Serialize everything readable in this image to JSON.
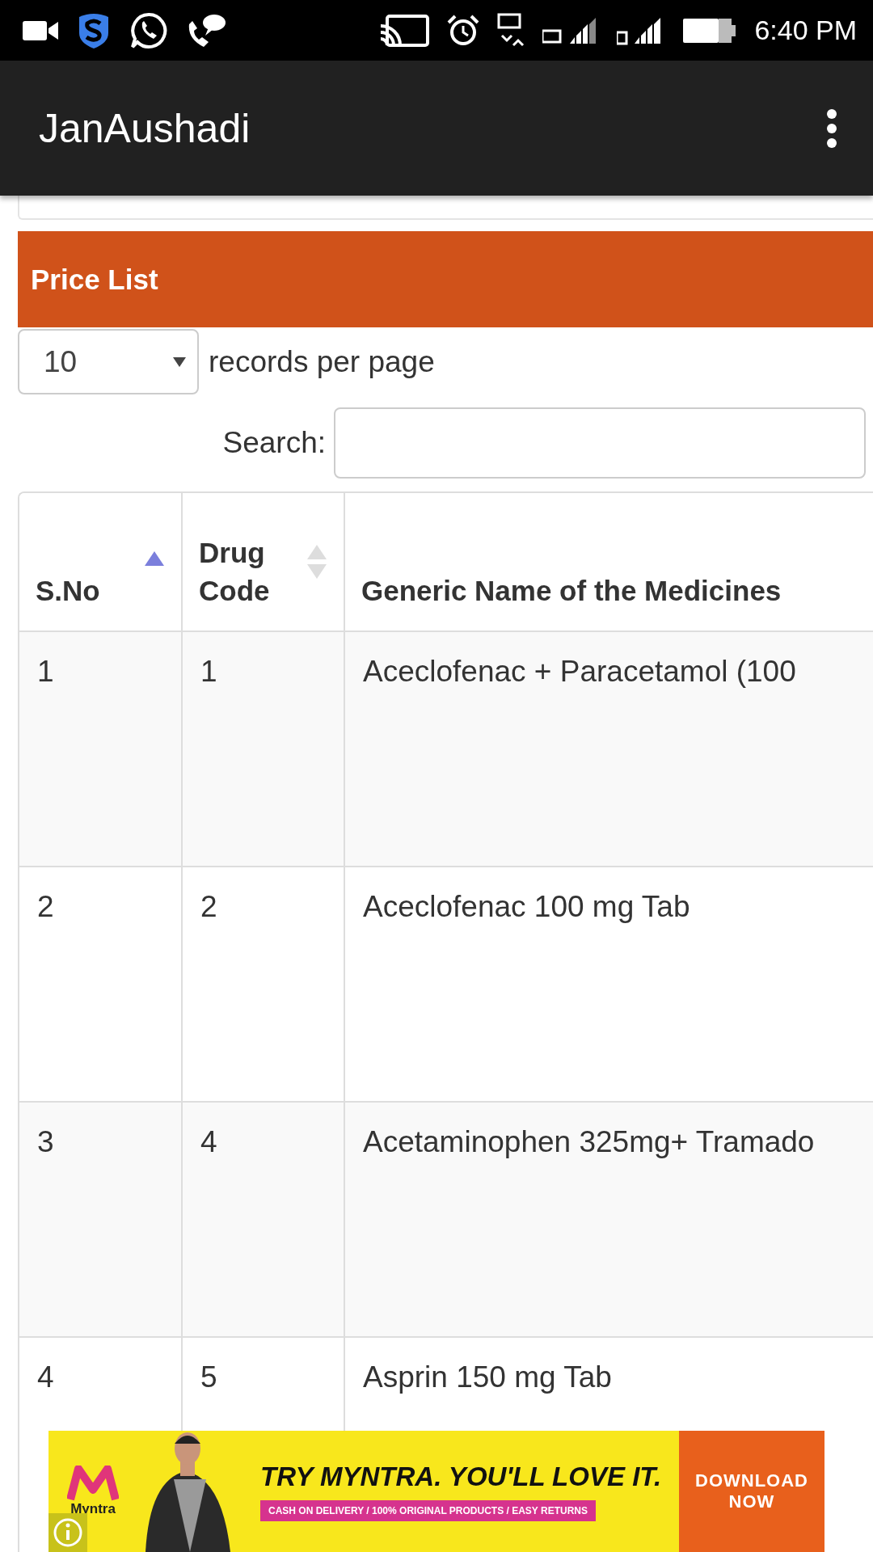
{
  "status_bar": {
    "time": "6:40 PM"
  },
  "app_bar": {
    "title": "JanAushadi"
  },
  "panel": {
    "title": "Price List"
  },
  "length_select": {
    "value": "10",
    "label": "records per page"
  },
  "search": {
    "label": "Search:"
  },
  "table": {
    "columns": [
      {
        "label": "S.No",
        "sortable": true,
        "sorted": true
      },
      {
        "label": "Drug Code",
        "sortable": true,
        "sorted": false
      },
      {
        "label": "Generic Name of the Medicines",
        "sortable": false,
        "sorted": false
      }
    ],
    "rows": [
      [
        "1",
        "1",
        "Aceclofenac + Paracetamol (100"
      ],
      [
        "2",
        "2",
        "Aceclofenac 100 mg Tab"
      ],
      [
        "3",
        "4",
        "Acetaminophen 325mg+ Tramado"
      ],
      [
        "4",
        "5",
        "Asprin 150 mg Tab"
      ]
    ]
  },
  "ad": {
    "brand": "Myntra",
    "headline": "TRY MYNTRA. YOU'LL LOVE IT.",
    "tagline": "CASH ON DELIVERY / 100% ORIGINAL PRODUCTS / EASY RETURNS",
    "cta": "DOWNLOAD NOW"
  }
}
